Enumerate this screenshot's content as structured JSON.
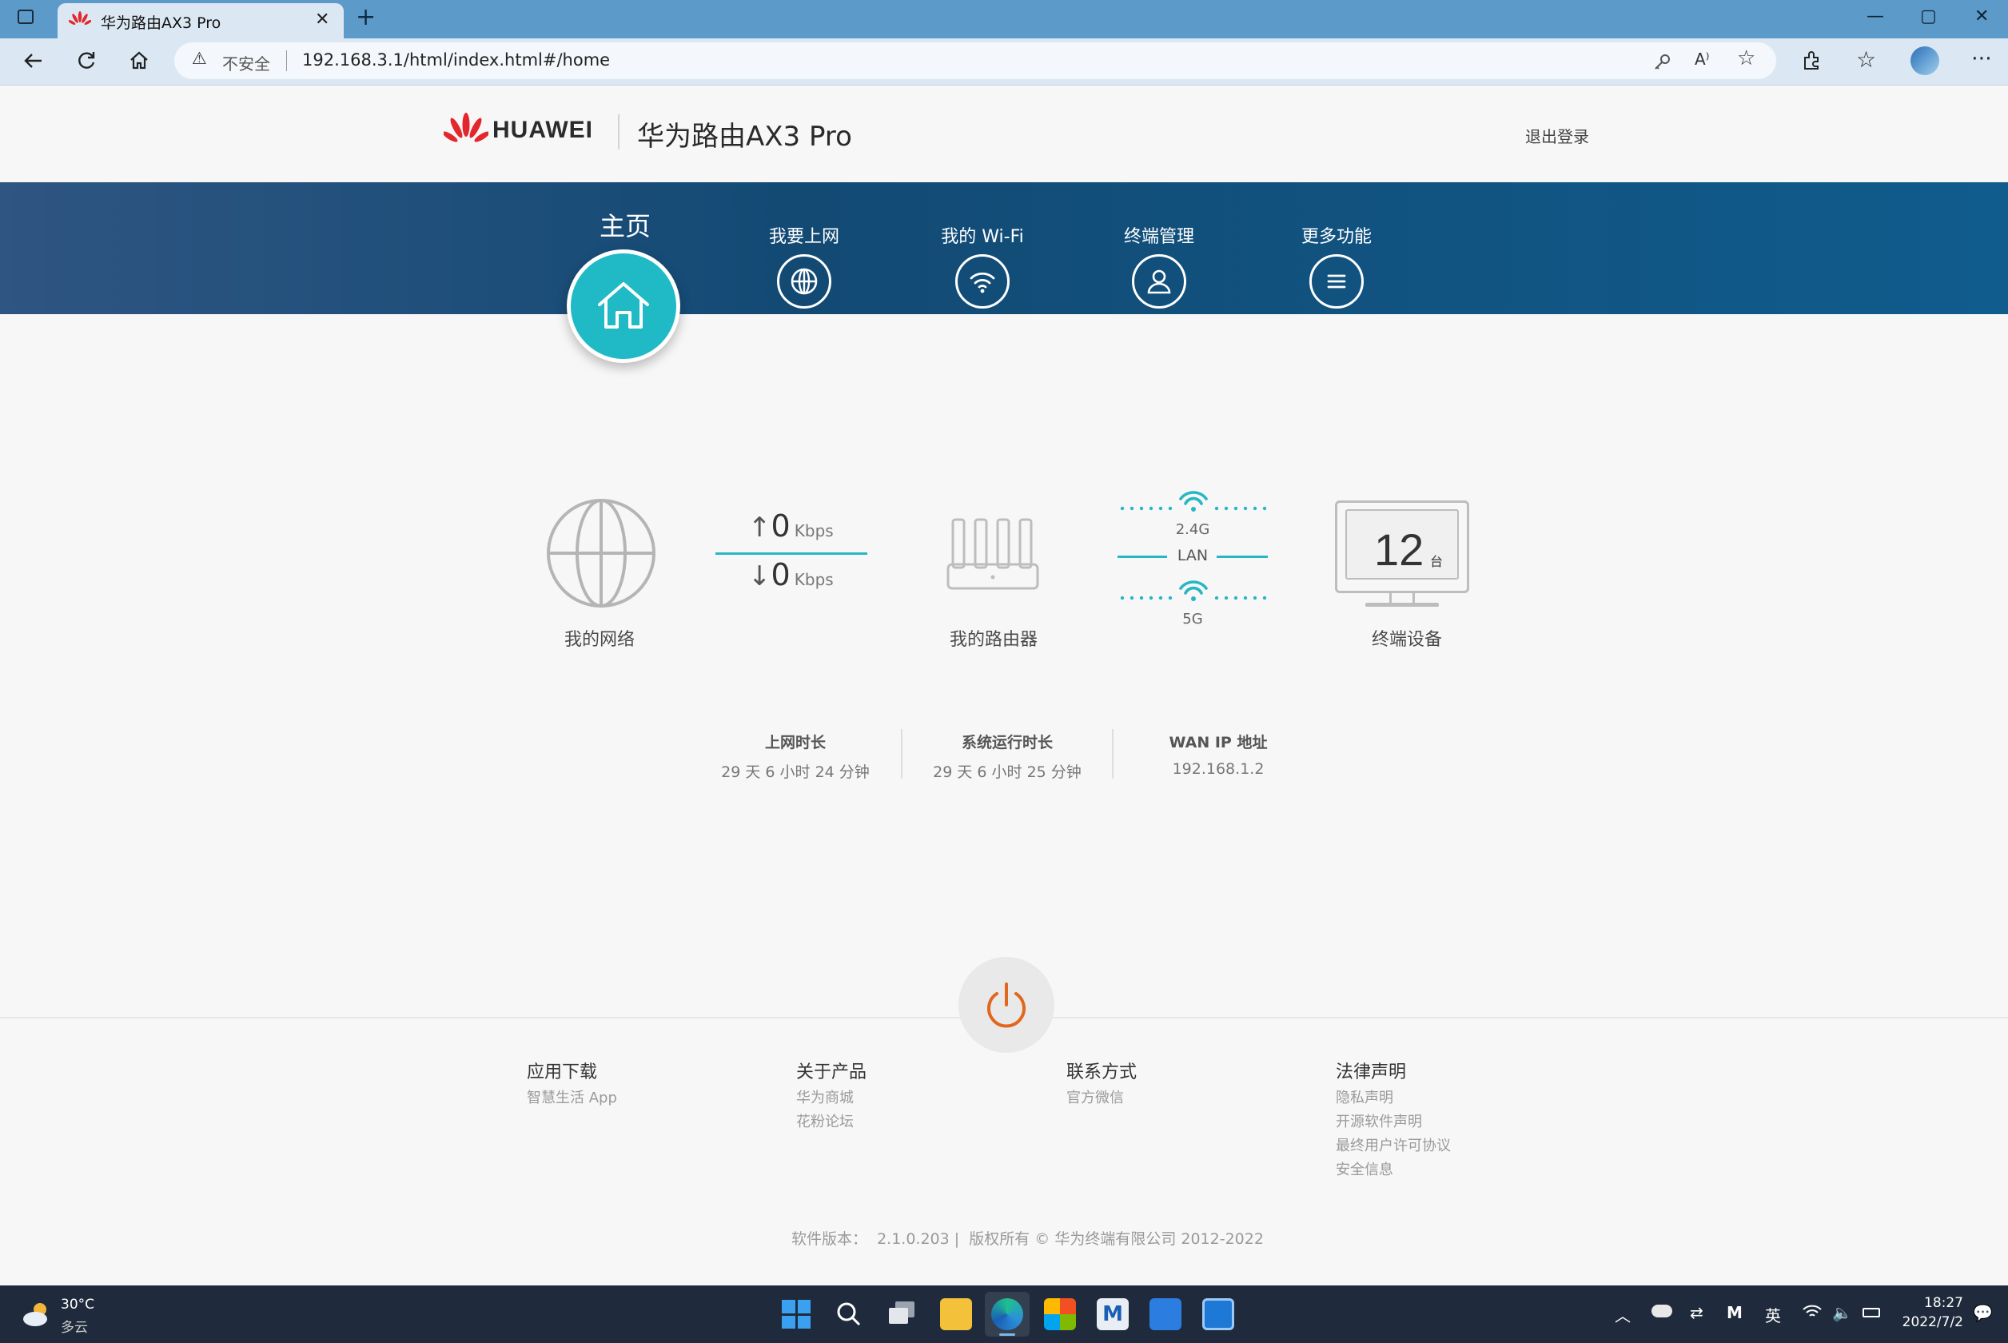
{
  "browser": {
    "tab_title": "华为路由AX3 Pro",
    "new_tab": "+",
    "close": "✕",
    "window_controls": [
      "—",
      "▢",
      "✕"
    ],
    "security_label": "不安全",
    "url": "192.168.3.1/html/index.html#/home",
    "icons": [
      "back-icon",
      "refresh-icon",
      "home-icon",
      "read-aloud-icon",
      "favorites-add-icon",
      "extensions-icon",
      "favorites-icon",
      "profile-icon",
      "more-icon"
    ]
  },
  "header": {
    "brand": "HUAWEI",
    "product": "华为路由AX3 Pro",
    "logout": "退出登录"
  },
  "nav": {
    "home": "主页",
    "items": [
      {
        "label": "我要上网",
        "icon": "globe-icon"
      },
      {
        "label": "我的 Wi-Fi",
        "icon": "wifi-icon"
      },
      {
        "label": "终端管理",
        "icon": "user-icon"
      },
      {
        "label": "更多功能",
        "icon": "menu-icon"
      }
    ]
  },
  "status": {
    "network_label": "我的网络",
    "upload_value": "0",
    "download_value": "0",
    "unit": "Kbps",
    "router_label": "我的路由器",
    "band_24": "2.4G",
    "lan": "LAN",
    "band_5": "5G",
    "device_count": "12",
    "device_unit": "台",
    "devices_label": "终端设备"
  },
  "info": [
    {
      "title": "上网时长",
      "value": "29 天 6 小时 24 分钟"
    },
    {
      "title": "系统运行时长",
      "value": "29 天 6 小时 25 分钟"
    },
    {
      "title": "WAN IP 地址",
      "value": "192.168.1.2"
    }
  ],
  "footer": {
    "columns": [
      {
        "title": "应用下载",
        "links": [
          "智慧生活 App"
        ]
      },
      {
        "title": "关于产品",
        "links": [
          "华为商城",
          "花粉论坛"
        ]
      },
      {
        "title": "联系方式",
        "links": [
          "官方微信"
        ]
      },
      {
        "title": "法律声明",
        "links": [
          "隐私声明",
          "开源软件声明",
          "最终用户许可协议",
          "安全信息"
        ]
      }
    ],
    "copyright": "软件版本：  2.1.0.203 |  版权所有 © 华为终端有限公司 2012-2022"
  },
  "taskbar": {
    "weather_temp": "30°C",
    "weather_desc": "多云",
    "ime": "英",
    "time": "18:27",
    "date": "2022/7/2"
  },
  "colors": {
    "accent_teal": "#20b9c6",
    "banner_blue": "#124a74",
    "power_orange": "#e2661e"
  }
}
